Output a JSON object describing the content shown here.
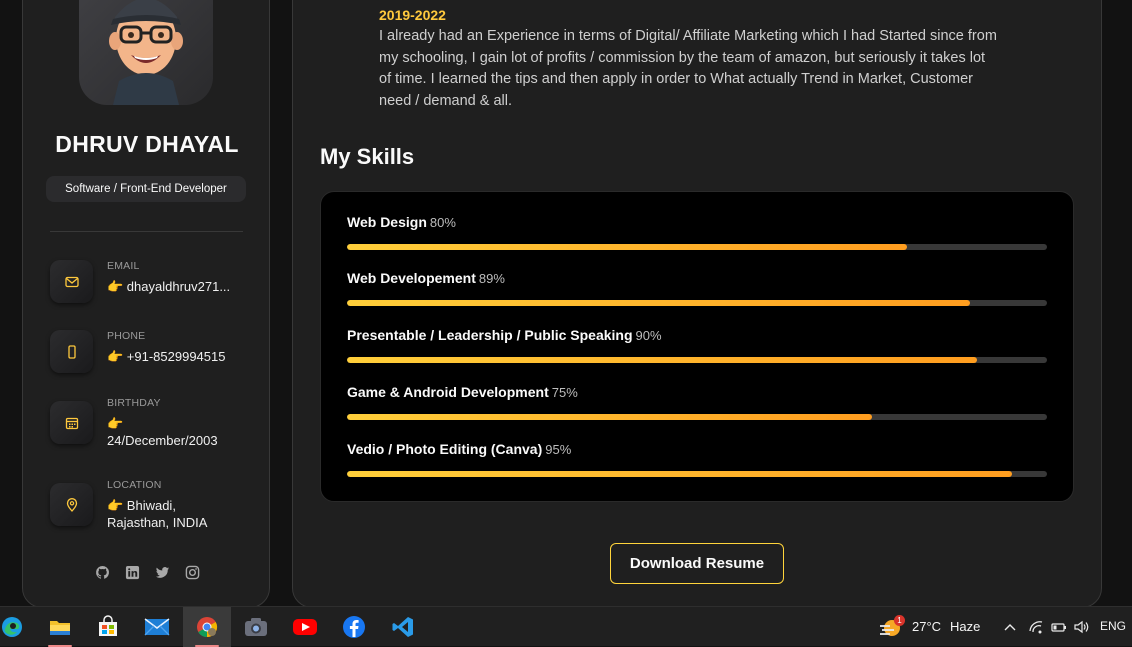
{
  "profile": {
    "name": "DHRUV DHAYAL",
    "role": "Software / Front-End Developer"
  },
  "contacts": [
    {
      "label": "EMAIL",
      "value": "👉 dhayaldhruv271...",
      "icon": "mail-icon"
    },
    {
      "label": "PHONE",
      "value": "👉 +91-8529994515",
      "icon": "phone-icon"
    },
    {
      "label": "BIRTHDAY",
      "value": "👉 24/December/2003",
      "icon": "calendar-icon"
    },
    {
      "label": "LOCATION",
      "value": "👉 Bhiwadi, Rajasthan, INDIA",
      "icon": "location-pin-icon"
    }
  ],
  "socials": [
    "github-icon",
    "linkedin-icon",
    "twitter-icon",
    "instagram-icon"
  ],
  "experience": {
    "years": "2019-2022",
    "text": "I already had an Experience in terms of Digital/ Affiliate Marketing which I had Started since from my schooling, I gain lot of profits / commission by the team of amazon, but seriously it takes lot of time. I learned the tips and then apply in order to What actually Trend in Market, Customer need / demand & all."
  },
  "skills_section": {
    "title": "My Skills",
    "items": [
      {
        "name": "Web Design",
        "percent_label": "80%",
        "percent": 80
      },
      {
        "name": "Web Developement",
        "percent_label": "89%",
        "percent": 89
      },
      {
        "name": "Presentable / Leadership / Public Speaking",
        "percent_label": "90%",
        "percent": 90
      },
      {
        "name": "Game & Android Development",
        "percent_label": "75%",
        "percent": 75
      },
      {
        "name": "Vedio / Photo Editing (Canva)",
        "percent_label": "95%",
        "percent": 95
      }
    ]
  },
  "download_button": "Download Resume",
  "taskbar": {
    "apps": [
      "edge-icon",
      "file-explorer-icon",
      "microsoft-store-icon",
      "mail-app-icon",
      "chrome-icon",
      "camera-icon",
      "youtube-icon",
      "facebook-icon",
      "vscode-icon"
    ],
    "weather_badge": "1",
    "temperature": "27°C",
    "condition": "Haze",
    "language": "ENG"
  },
  "colors": {
    "accent": "#ffc93d",
    "panel": "#1f1f1f",
    "background": "#121212"
  }
}
